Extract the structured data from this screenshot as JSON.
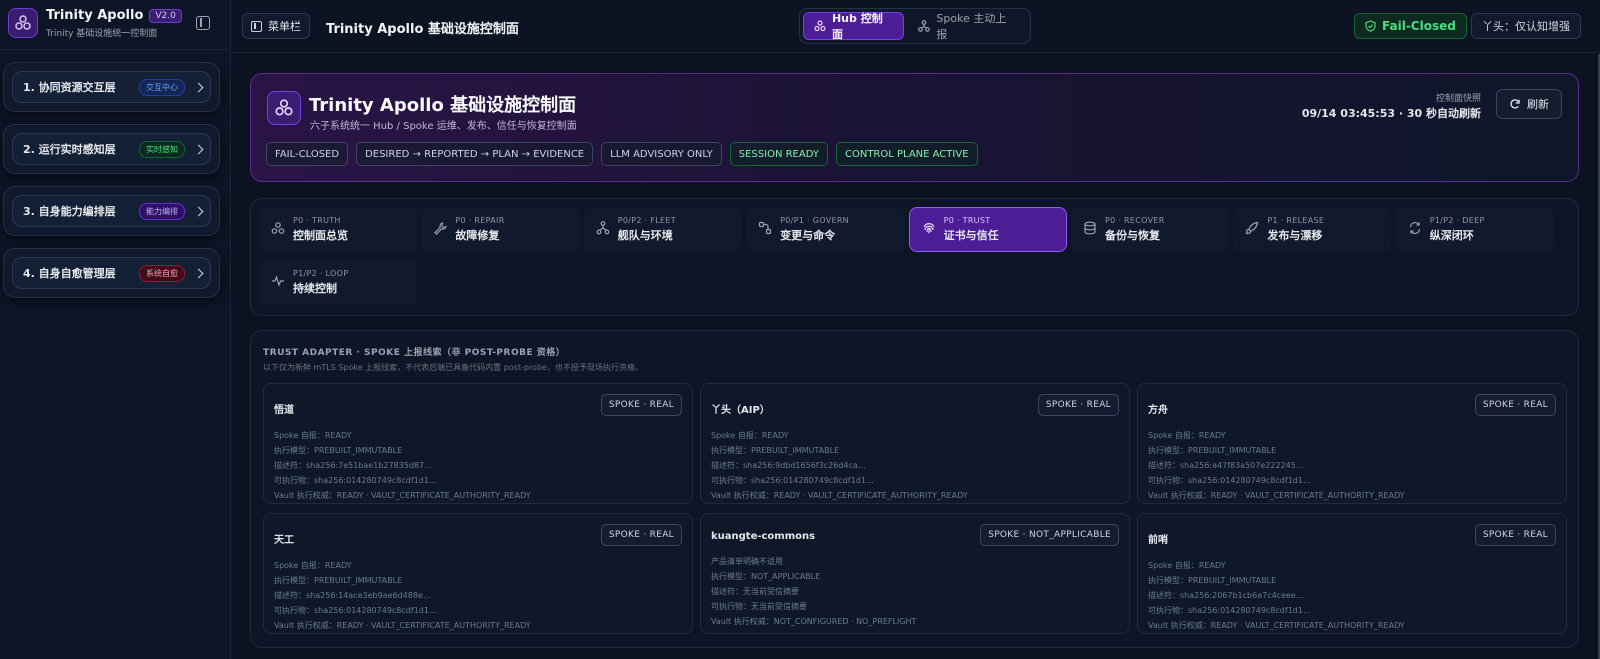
{
  "brand": {
    "title": "Trinity Apollo",
    "version": "V2.0",
    "subtitle": "Trinity 基础设施统一控制面"
  },
  "sidebar": {
    "layers": [
      {
        "label": "1. 协同资源交互层",
        "badge": "交互中心",
        "badge_color": "#60a5fa",
        "badge_bg": "#172554",
        "badge_border": "#1e40af"
      },
      {
        "label": "2. 运行实时感知层",
        "badge": "实时感知",
        "badge_color": "#4ade80",
        "badge_bg": "#0d2a20",
        "badge_border": "#166534"
      },
      {
        "label": "3. 自身能力编排层",
        "badge": "能力编排",
        "badge_color": "#c4b5fd",
        "badge_bg": "#2e1065",
        "badge_border": "#6d28d9"
      },
      {
        "label": "4. 自身自愈管理层",
        "badge": "系统自愈",
        "badge_color": "#fda4af",
        "badge_bg": "#3f0d1a",
        "badge_border": "#9f1239"
      }
    ]
  },
  "topbar": {
    "menu_label": "菜单栏",
    "title": "Trinity Apollo 基础设施控制面",
    "modes": [
      "Hub 控制面",
      "Spoke 主动上报"
    ],
    "fail_closed": "Fail-Closed",
    "mode_pill": "丫头：仅认知增强"
  },
  "hero": {
    "title": "Trinity Apollo 基础设施控制面",
    "subtitle": "六子系统统一 Hub / Spoke 运维、发布、信任与恢复控制面",
    "tags": [
      {
        "label": "FAIL-CLOSED",
        "green": false
      },
      {
        "label": "DESIRED → REPORTED → PLAN → EVIDENCE",
        "green": false
      },
      {
        "label": "LLM ADVISORY ONLY",
        "green": false
      },
      {
        "label": "SESSION READY",
        "green": true
      },
      {
        "label": "CONTROL PLANE ACTIVE",
        "green": true
      }
    ],
    "snapshot_label": "控制面快照",
    "snapshot_time": "09/14 03:45:53 · 30 秒自动刷新",
    "refresh_label": "刷新"
  },
  "nav": {
    "items": [
      {
        "code": "P0 · TRUTH",
        "label": "控制面总览",
        "icon": "cluster-icon"
      },
      {
        "code": "P0 · REPAIR",
        "label": "故障修复",
        "icon": "wrench-icon"
      },
      {
        "code": "P0/P2 · FLEET",
        "label": "舰队与环境",
        "icon": "fleet-icon"
      },
      {
        "code": "P0/P1 · GOVERN",
        "label": "变更与命令",
        "icon": "govern-icon"
      },
      {
        "code": "P0 · TRUST",
        "label": "证书与信任",
        "icon": "fingerprint-icon",
        "active": true
      },
      {
        "code": "P0 · RECOVER",
        "label": "备份与恢复",
        "icon": "database-icon"
      },
      {
        "code": "P1 · RELEASE",
        "label": "发布与漂移",
        "icon": "rocket-icon"
      },
      {
        "code": "P1/P2 · DEEP",
        "label": "纵深闭环",
        "icon": "loop-icon"
      },
      {
        "code": "P1/P2 · LOOP",
        "label": "持续控制",
        "icon": "pulse-icon"
      }
    ]
  },
  "trust": {
    "title": "TRUST ADAPTER · SPOKE 上报线索（非 POST-PROBE 资格）",
    "subtitle": "以下仅为新鲜 mTLS Spoke 上报线索，不代表后端已具备代码内置 post-probe，也不授予现场执行资格。",
    "spokes": [
      {
        "name": "悟道",
        "badge": "SPOKE · REAL",
        "lines": [
          "Spoke 自报：READY",
          "执行模型：PREBUILT_IMMUTABLE",
          "描述符：sha256:7e51bae1b27835d87…",
          "可执行物：sha256:014280749c8cdf1d1…",
          "Vault 执行权威：READY · VAULT_CERTIFICATE_AUTHORITY_READY"
        ]
      },
      {
        "name": "丫头（AIP）",
        "badge": "SPOKE · REAL",
        "lines": [
          "Spoke 自报：READY",
          "执行模型：PREBUILT_IMMUTABLE",
          "描述符：sha256:9dbd1656f3c26d4ca…",
          "可执行物：sha256:014280749c8cdf1d1…",
          "Vault 执行权威：READY · VAULT_CERTIFICATE_AUTHORITY_READY"
        ]
      },
      {
        "name": "方舟",
        "badge": "SPOKE · REAL",
        "lines": [
          "Spoke 自报：READY",
          "执行模型：PREBUILT_IMMUTABLE",
          "描述符：sha256:a47f83a507e222245…",
          "可执行物：sha256:014280749c8cdf1d1…",
          "Vault 执行权威：READY · VAULT_CERTIFICATE_AUTHORITY_READY"
        ]
      },
      {
        "name": "天工",
        "badge": "SPOKE · REAL",
        "lines": [
          "Spoke 自报：READY",
          "执行模型：PREBUILT_IMMUTABLE",
          "描述符：sha256:14ace3eb9ae6d488e…",
          "可执行物：sha256:014280749c8cdf1d1…",
          "Vault 执行权威：READY · VAULT_CERTIFICATE_AUTHORITY_READY"
        ]
      },
      {
        "name": "kuangte-commons",
        "badge": "SPOKE · NOT_APPLICABLE",
        "lines": [
          "产品清单明确不适用",
          "执行模型：NOT_APPLICABLE",
          "描述符：无当前受信摘要",
          "可执行物：无当前受信摘要",
          "Vault 执行权威：NOT_CONFIGURED · NO_PREFLIGHT"
        ]
      },
      {
        "name": "前哨",
        "badge": "SPOKE · REAL",
        "lines": [
          "Spoke 自报：READY",
          "执行模型：PREBUILT_IMMUTABLE",
          "描述符：sha256:2067b1cb6a7c4ceee…",
          "可执行物：sha256:014280749c8cdf1d1…",
          "Vault 执行权威：READY · VAULT_CERTIFICATE_AUTHORITY_READY"
        ]
      }
    ]
  },
  "colors": {
    "accent": "#7c3aed",
    "background": "#0b1220",
    "success": "#4ade80"
  }
}
